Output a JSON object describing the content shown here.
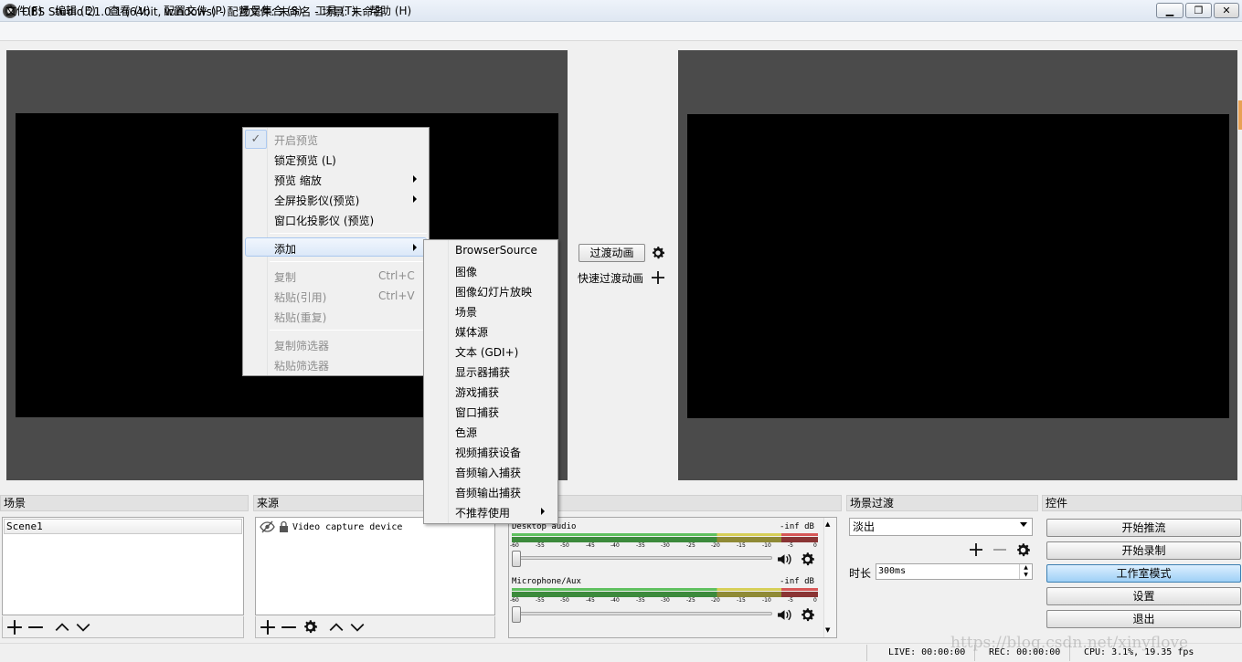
{
  "window": {
    "title": "OBS Studio 21.0.1 (64bit, windows) - 配置文件: 未命名 - 场景: 未命名",
    "minimize": "▁",
    "maximize": "❐",
    "close": "✕"
  },
  "menubar": {
    "items": [
      "文件(F)",
      "编辑 (E)",
      "查看 (V)",
      "配置文件 (P)",
      "场景集合 (S)",
      "工具 (T)",
      "帮助 (H)"
    ]
  },
  "transition": {
    "button_label": "过渡动画",
    "quick_label": "快速过渡动画"
  },
  "context_menu": {
    "items": [
      {
        "label": "开启预览",
        "disabled": true,
        "checked": true
      },
      {
        "label": "锁定预览 (L)"
      },
      {
        "label": "预览  缩放",
        "submenu": true
      },
      {
        "label": "全屏投影仪(预览)",
        "submenu": true
      },
      {
        "label": "窗口化投影仪 (预览)"
      },
      {
        "label": "添加",
        "submenu": true,
        "highlighted": true
      },
      {
        "label": "复制",
        "shortcut": "Ctrl+C",
        "disabled": true
      },
      {
        "label": "粘贴(引用)",
        "shortcut": "Ctrl+V",
        "disabled": true
      },
      {
        "label": "粘贴(重复)",
        "disabled": true
      },
      {
        "label": "复制筛选器",
        "disabled": true
      },
      {
        "label": "粘贴筛选器",
        "disabled": true
      }
    ]
  },
  "add_submenu": {
    "items": [
      "BrowserSource",
      "图像",
      "图像幻灯片放映",
      "场景",
      "媒体源",
      "文本 (GDI+)",
      "显示器捕获",
      "游戏捕获",
      "窗口捕获",
      "色源",
      "视频捕获设备",
      "音频输入捕获",
      "音频输出捕获",
      "不推荐使用"
    ]
  },
  "docks": {
    "scenes": {
      "title": "场景",
      "items": [
        "Scene1"
      ]
    },
    "sources": {
      "title": "来源",
      "items": [
        "Video capture device"
      ]
    },
    "mixer": {
      "title": "",
      "channels": [
        {
          "name": "Desktop audio",
          "level": "-inf dB"
        },
        {
          "name": "Microphone/Aux",
          "level": "-inf dB"
        }
      ],
      "ticks": [
        "-60",
        "-55",
        "-50",
        "-45",
        "-40",
        "-35",
        "-30",
        "-25",
        "-20",
        "-15",
        "-10",
        "-5",
        "0"
      ]
    },
    "transitions": {
      "title": "场景过渡",
      "selected": "淡出",
      "duration_label": "时长",
      "duration_value": "300ms"
    },
    "controls": {
      "title": "控件",
      "buttons": [
        "开始推流",
        "开始录制",
        "工作室模式",
        "设置",
        "退出"
      ]
    }
  },
  "statusbar": {
    "live": "LIVE: 00:00:00",
    "rec": "REC: 00:00:00",
    "cpu": "CPU: 3.1%, 19.35 fps"
  },
  "watermark": "https://blog.csdn.net/xinyflove",
  "icons": {
    "gear": "gear-icon",
    "plus": "plus-icon",
    "minus": "minus-icon",
    "up": "arrow-up-icon",
    "down": "arrow-down-icon",
    "eye": "eye-hidden-icon",
    "lock": "lock-icon",
    "speaker": "speaker-icon"
  },
  "colors": {
    "canvas_bg": "#4b4b4b",
    "studio_mode_active": "#9fd0f6"
  }
}
